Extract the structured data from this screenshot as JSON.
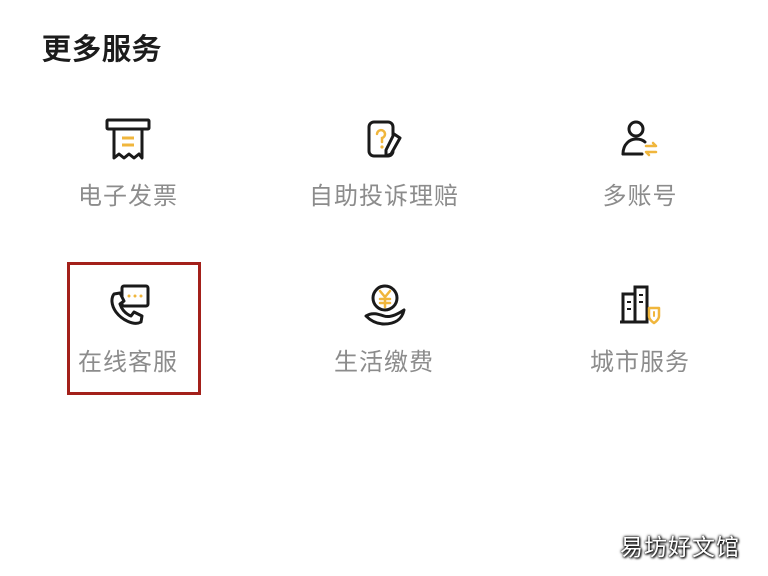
{
  "section": {
    "title": "更多服务"
  },
  "items": [
    {
      "label": "电子发票",
      "icon": "receipt-icon"
    },
    {
      "label": "自助投诉理赔",
      "icon": "claim-edit-icon"
    },
    {
      "label": "多账号",
      "icon": "switch-account-icon"
    },
    {
      "label": "在线客服",
      "icon": "customer-service-phone-icon"
    },
    {
      "label": "生活缴费",
      "icon": "bill-payment-icon"
    },
    {
      "label": "城市服务",
      "icon": "city-service-icon"
    }
  ],
  "watermark": {
    "text": "易坊好文馆"
  },
  "colors": {
    "accent": "#F0B63C",
    "icon_stroke": "#1a1a1a",
    "label": "#8c8c8c",
    "highlight": "#a3201a"
  }
}
